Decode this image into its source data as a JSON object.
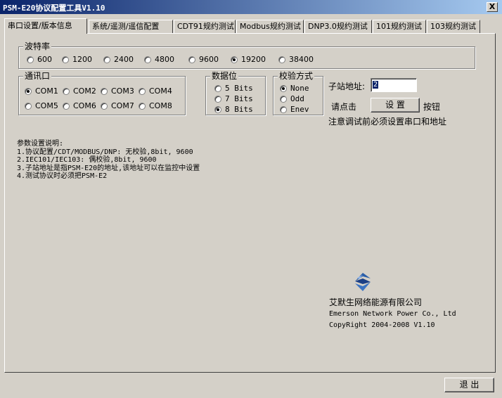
{
  "window": {
    "title": "PSM-E20协议配置工具V1.10",
    "close_label": "X"
  },
  "tabs": [
    {
      "label": "串口设置/版本信息",
      "active": true
    },
    {
      "label": "系统/遥测/遥信配置",
      "active": false
    },
    {
      "label": "CDT91规约测试",
      "active": false
    },
    {
      "label": "Modbus规约测试",
      "active": false
    },
    {
      "label": "DNP3.0规约测试",
      "active": false
    },
    {
      "label": "101规约测试",
      "active": false
    },
    {
      "label": "103规约测试",
      "active": false
    }
  ],
  "baud": {
    "label": "波特率",
    "options": [
      "600",
      "1200",
      "2400",
      "4800",
      "9600",
      "19200",
      "38400"
    ],
    "selected": "19200"
  },
  "port": {
    "label": "通讯口",
    "options": [
      "COM1",
      "COM2",
      "COM3",
      "COM4",
      "COM5",
      "COM6",
      "COM7",
      "COM8"
    ],
    "selected": "COM1"
  },
  "databits": {
    "label": "数据位",
    "options": [
      "5 Bits",
      "7 Bits",
      "8 Bits"
    ],
    "selected": "8 Bits"
  },
  "parity": {
    "label": "校验方式",
    "options": [
      "None",
      "Odd",
      "Enev"
    ],
    "selected": "None"
  },
  "station": {
    "label": "子站地址:",
    "value": "2",
    "prompt_prefix": "请点击",
    "button_label": "设 置",
    "prompt_suffix": "按钮",
    "notice": "注意调试前必须设置串口和地址"
  },
  "instructions": {
    "title": "参数设置说明:",
    "lines": [
      "1.协议配置/CDT/MODBUS/DNP: 无校验,8bit, 9600",
      "2.IEC101/IEC103: 偶校验,8bit, 9600",
      "3.子站地址是指PSM-E20的地址,该地址可以在监控中设置",
      "4.测试协议时必须把PSM-E2"
    ]
  },
  "company": {
    "logo_icon": "emerson-logo-icon",
    "name_cn": "艾默生网络能源有限公司",
    "name_en": "Emerson Network Power Co., Ltd",
    "copyright": "CopyRight 2004-2008   V1.10"
  },
  "footer": {
    "exit_label": "退 出"
  }
}
